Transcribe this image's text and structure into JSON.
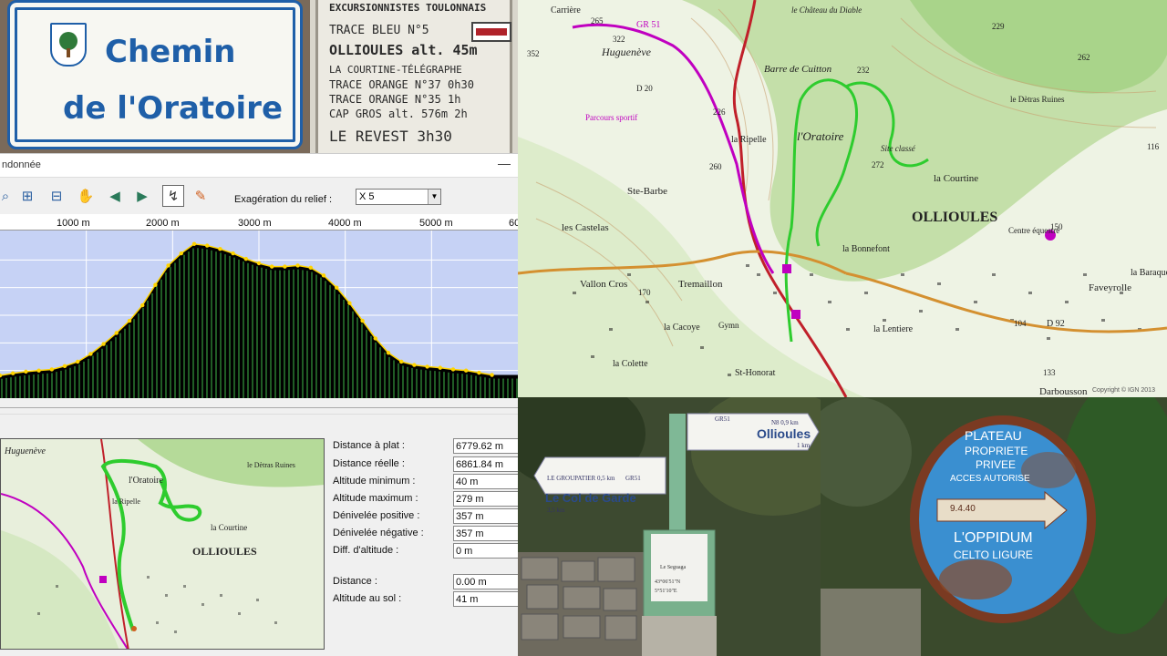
{
  "street_sign": {
    "line1": "Chemin",
    "line2": "de l'Oratoire"
  },
  "trail_board": {
    "header": "EXCURSIONNISTES TOULONNAIS",
    "lines": [
      "TRACE BLEU N°5",
      "OLLIOULES alt. 45m",
      "LA COURTINE-TÉLÉGRAPHE",
      "TRACE ORANGE N°37 0h30",
      "TRACE ORANGE N°35  1h",
      "CAP GROS alt. 576m 2h",
      "LE REVEST  3h30"
    ],
    "marker_color": "#b0222a"
  },
  "topo_map": {
    "labels": [
      "Carrière",
      "Huguenève",
      "GR 51",
      "le Château du Diable",
      "Barre de Cuitton",
      "le Dètras Ruines",
      "la Ripelle",
      "l'Oratoire",
      "Site classé",
      "la Courtine",
      "Ste-Barbe",
      "les Castelas",
      "OLLIOULES",
      "la Bonnefont",
      "Centre équestre",
      "la Baraque",
      "Vallon Cros",
      "Tremaillon",
      "Faveyrolle",
      "la Cacoye",
      "Gymn",
      "la Colette",
      "St-Honorat",
      "Darbousson",
      "la Lentiere",
      "D 92",
      "D 20",
      "Parcours sportif",
      "Copyright © IGN 2013"
    ],
    "elevations": [
      "265",
      "322",
      "352",
      "229",
      "262",
      "232",
      "226",
      "116",
      "260",
      "272",
      "150",
      "170",
      "104",
      "133"
    ],
    "route_color": "#2ecc2e",
    "gr_color": "#c000c0"
  },
  "software": {
    "window_title": "ndonnée",
    "toolbar_icons": [
      "zoom-in-icon",
      "zoom-region-icon",
      "zoom-out-icon",
      "pan-hand-icon",
      "arrow-left-icon",
      "arrow-right-icon",
      "profile-toggle-icon",
      "measure-icon"
    ],
    "exaggeration_label": "Exagération du relief :",
    "exaggeration_value": "X 5",
    "ruler_ticks": [
      "1000 m",
      "2000 m",
      "3000 m",
      "4000 m",
      "5000 m",
      "60"
    ],
    "stats": [
      {
        "label": "Distance à plat :",
        "value": "6779.62 m"
      },
      {
        "label": "Distance réelle :",
        "value": "6861.84 m"
      },
      {
        "label": "Altitude minimum :",
        "value": "40 m"
      },
      {
        "label": "Altitude maximum :",
        "value": "279 m"
      },
      {
        "label": "Dénivelée positive :",
        "value": "357 m"
      },
      {
        "label": "Dénivelée négative :",
        "value": "357 m"
      },
      {
        "label": "Diff. d'altitude :",
        "value": "0 m"
      }
    ],
    "cursor": [
      {
        "label": "Distance :",
        "value": "0.00 m"
      },
      {
        "label": "Altitude au sol :",
        "value": "41 m"
      }
    ],
    "minimap_labels": [
      "Huguenève",
      "l'Oratoire",
      "la Courtine",
      "OLLIOULES",
      "la Ripelle",
      "le Dètras Ruines"
    ]
  },
  "chart_data": {
    "type": "area",
    "x": [
      0,
      150,
      300,
      450,
      600,
      750,
      900,
      1050,
      1200,
      1350,
      1500,
      1650,
      1800,
      1950,
      2100,
      2250,
      2400,
      2550,
      2700,
      2850,
      3000,
      3150,
      3300,
      3450,
      3600,
      3750,
      3900,
      4050,
      4200,
      4350,
      4500,
      4650,
      4800,
      4950,
      5100,
      5250,
      5400,
      5550,
      5700
    ],
    "y": [
      41,
      45,
      48,
      50,
      52,
      58,
      66,
      80,
      98,
      118,
      140,
      168,
      205,
      240,
      262,
      279,
      276,
      270,
      262,
      252,
      244,
      238,
      238,
      240,
      236,
      222,
      200,
      172,
      140,
      108,
      82,
      66,
      60,
      57,
      55,
      52,
      50,
      46,
      42
    ],
    "xlim": [
      0,
      6000
    ],
    "ylim": [
      0,
      300
    ],
    "grid": true,
    "fill_color": "#000000",
    "stripe_color": "#3fb84a",
    "marker_color": "#ffd400"
  },
  "signpost": {
    "top_sign_label": "GR51",
    "top_sign_sub": "N8 0,9 km",
    "top_sign_main": "Ollioules",
    "top_sign_dist": "1 km",
    "left_sign_label": "GR51",
    "left_sign_sub": "LE GROUPATIER 0,5 km",
    "left_sign_main": "Le Col de Garde",
    "left_sign_dist": "3,5 km",
    "plate_title": "Le Seguaga",
    "plate_coords_lat": "43°06'51\"N",
    "plate_coords_lon": "5°51'10\"E"
  },
  "rusty_sign": {
    "line1": "PLATEAU",
    "line2": "PROPRIETE",
    "line3": "PRIVEE",
    "line4": "ACCES AUTORISE",
    "arrow_text": "9.4.40",
    "line5": "L'OPPIDUM",
    "line6": "CELTO LIGURE",
    "disc_color": "#3a8fd0",
    "rim_color": "#7a3a22"
  }
}
